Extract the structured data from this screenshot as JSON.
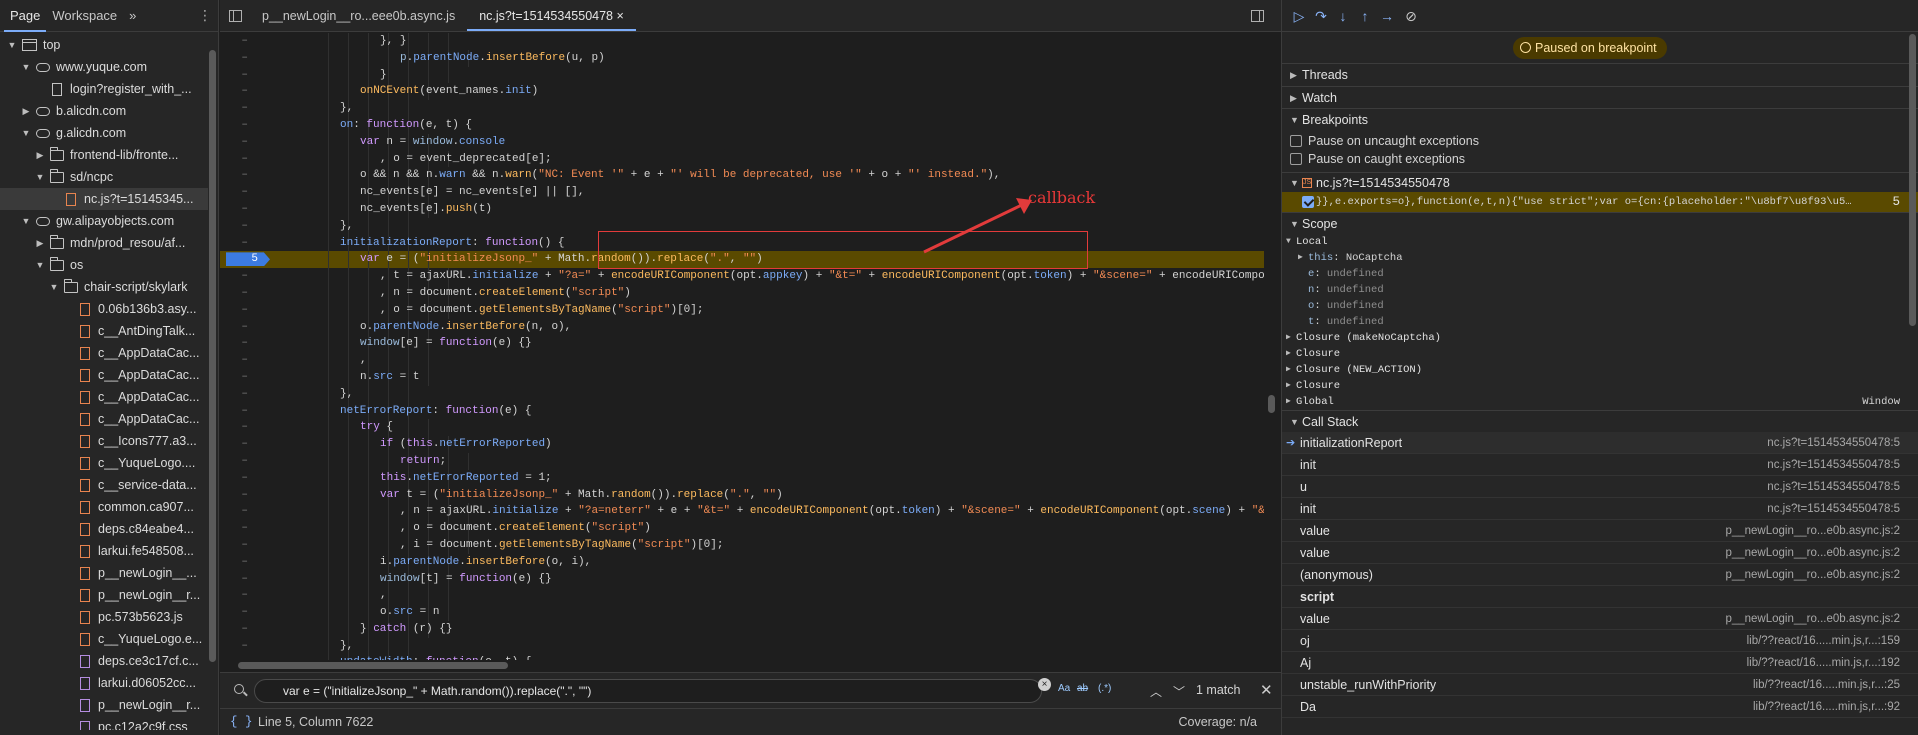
{
  "navigator": {
    "tabs": [
      "Page",
      "Workspace"
    ],
    "more": "»",
    "tree": [
      {
        "label": "top",
        "indent": 0,
        "icon": "frame",
        "arrow": "down"
      },
      {
        "label": "www.yuque.com",
        "indent": 1,
        "icon": "cloud",
        "arrow": "down"
      },
      {
        "label": "login?register_with_...",
        "indent": 2,
        "icon": "doc",
        "arrow": ""
      },
      {
        "label": "b.alicdn.com",
        "indent": 1,
        "icon": "cloud",
        "arrow": "right"
      },
      {
        "label": "g.alicdn.com",
        "indent": 1,
        "icon": "cloud",
        "arrow": "down"
      },
      {
        "label": "frontend-lib/fronte...",
        "indent": 2,
        "icon": "folder",
        "arrow": "right"
      },
      {
        "label": "sd/ncpc",
        "indent": 2,
        "icon": "folder",
        "arrow": "down"
      },
      {
        "label": "nc.js?t=15145345...",
        "indent": 3,
        "icon": "jsdoc",
        "arrow": "",
        "selected": true
      },
      {
        "label": "gw.alipayobjects.com",
        "indent": 1,
        "icon": "cloud",
        "arrow": "down"
      },
      {
        "label": "mdn/prod_resou/af...",
        "indent": 2,
        "icon": "folder",
        "arrow": "right"
      },
      {
        "label": "os",
        "indent": 2,
        "icon": "folder",
        "arrow": "down"
      },
      {
        "label": "chair-script/skylark",
        "indent": 3,
        "icon": "folder",
        "arrow": "down"
      },
      {
        "label": "0.06b136b3.asy...",
        "indent": 4,
        "icon": "jsdoc",
        "arrow": ""
      },
      {
        "label": "c__AntDingTalk...",
        "indent": 4,
        "icon": "jsdoc",
        "arrow": ""
      },
      {
        "label": "c__AppDataCac...",
        "indent": 4,
        "icon": "jsdoc",
        "arrow": ""
      },
      {
        "label": "c__AppDataCac...",
        "indent": 4,
        "icon": "jsdoc",
        "arrow": ""
      },
      {
        "label": "c__AppDataCac...",
        "indent": 4,
        "icon": "jsdoc",
        "arrow": ""
      },
      {
        "label": "c__AppDataCac...",
        "indent": 4,
        "icon": "jsdoc",
        "arrow": ""
      },
      {
        "label": "c__Icons777.a3...",
        "indent": 4,
        "icon": "jsdoc",
        "arrow": ""
      },
      {
        "label": "c__YuqueLogo....",
        "indent": 4,
        "icon": "jsdoc",
        "arrow": ""
      },
      {
        "label": "c__service-data...",
        "indent": 4,
        "icon": "jsdoc",
        "arrow": ""
      },
      {
        "label": "common.ca907...",
        "indent": 4,
        "icon": "jsdoc",
        "arrow": ""
      },
      {
        "label": "deps.c84eabe4...",
        "indent": 4,
        "icon": "jsdoc",
        "arrow": ""
      },
      {
        "label": "larkui.fe548508...",
        "indent": 4,
        "icon": "jsdoc",
        "arrow": ""
      },
      {
        "label": "p__newLogin__...",
        "indent": 4,
        "icon": "jsdoc",
        "arrow": ""
      },
      {
        "label": "p__newLogin__r...",
        "indent": 4,
        "icon": "jsdoc",
        "arrow": ""
      },
      {
        "label": "pc.573b5623.js",
        "indent": 4,
        "icon": "jsdoc",
        "arrow": ""
      },
      {
        "label": "c__YuqueLogo.e...",
        "indent": 4,
        "icon": "jsdoc",
        "arrow": ""
      },
      {
        "label": "deps.ce3c17cf.c...",
        "indent": 4,
        "icon": "cssdoc",
        "arrow": ""
      },
      {
        "label": "larkui.d06052cc...",
        "indent": 4,
        "icon": "cssdoc",
        "arrow": ""
      },
      {
        "label": "p__newLogin__r...",
        "indent": 4,
        "icon": "cssdoc",
        "arrow": ""
      },
      {
        "label": "pc.c12a2c9f.css",
        "indent": 4,
        "icon": "cssdoc",
        "arrow": ""
      }
    ]
  },
  "editor": {
    "tabs": [
      {
        "label": "p__newLogin__ro...eee0b.async.js",
        "active": false
      },
      {
        "label": "nc.js?t=1514534550478",
        "active": true,
        "closable": "×"
      }
    ],
    "annotation": "callback",
    "lines": [
      {
        "gutter": "–",
        "indent": 8,
        "html": "<span class='plain'>}, </span><span class='plain'>}</span>"
      },
      {
        "gutter": "–",
        "indent": 9,
        "html": "<span class='var'>p</span><span class='plain'>.</span><span class='prop'>parentNode</span><span class='plain'>.</span><span class='fn'>insertBefore</span><span class='plain'>(u, p)</span>"
      },
      {
        "gutter": "–",
        "indent": 8,
        "html": "<span class='plain'>}</span>"
      },
      {
        "gutter": "–",
        "indent": 7,
        "html": "<span class='fn'>onNCEvent</span><span class='plain'>(event_names.</span><span class='prop'>init</span><span class='plain'>)</span>"
      },
      {
        "gutter": "–",
        "indent": 6,
        "html": "<span class='plain'>},</span>"
      },
      {
        "gutter": "–",
        "indent": 6,
        "html": "<span class='prop'>on</span><span class='plain'>: </span><span class='kw'>function</span><span class='plain'>(e, t) {</span>"
      },
      {
        "gutter": "–",
        "indent": 7,
        "html": "<span class='kw'>var</span><span class='plain'> n = </span><span class='var'>window</span><span class='plain'>.</span><span class='prop'>console</span>"
      },
      {
        "gutter": "–",
        "indent": 8,
        "html": "<span class='plain'>, o = event_deprecated[e];</span>"
      },
      {
        "gutter": "–",
        "indent": 7,
        "html": "<span class='plain'>o &amp;&amp; n &amp;&amp; n.</span><span class='prop'>warn</span><span class='plain'> &amp;&amp; n.</span><span class='fn'>warn</span><span class='plain'>(</span><span class='str'>\"NC: Event '\"</span><span class='plain'> + e + </span><span class='str'>\"' will be deprecated, use '\"</span><span class='plain'> + o + </span><span class='str'>\"' instead.\"</span><span class='plain'>),</span>"
      },
      {
        "gutter": "–",
        "indent": 7,
        "html": "<span class='plain'>nc_events[e] = nc_events[e] || [],</span>"
      },
      {
        "gutter": "–",
        "indent": 7,
        "html": "<span class='plain'>nc_events[e].</span><span class='fn'>push</span><span class='plain'>(t)</span>"
      },
      {
        "gutter": "–",
        "indent": 6,
        "html": "<span class='plain'>},</span>"
      },
      {
        "gutter": "–",
        "indent": 6,
        "html": "<span class='prop'>initializationReport</span><span class='plain'>: </span><span class='kw'>function</span><span class='plain'>() {</span>"
      },
      {
        "gutter": "5",
        "indent": 7,
        "bp": true,
        "html": "<span class='kw'>var</span><span class='plain'> e = </span><span class='plain'>(</span><span class='str'>\"initializeJsonp_\"</span><span class='plain'> + Math.</span><span class='fn'>random</span><span class='plain'>()).</span><span class='fn'>replace</span><span class='plain'>(</span><span class='str'>\".\"</span><span class='plain'>, </span><span class='str'>\"\"</span><span class='plain'>)</span>"
      },
      {
        "gutter": "–",
        "indent": 8,
        "html": "<span class='plain'>, t = ajaxURL.</span><span class='prop'>initialize</span><span class='plain'> + </span><span class='str'>\"?a=\"</span><span class='plain'> + </span><span class='fn'>encodeURIComponent</span><span class='plain'>(opt.</span><span class='prop'>appkey</span><span class='plain'>) + </span><span class='str'>\"&amp;t=\"</span><span class='plain'> + </span><span class='fn'>encodeURIComponent</span><span class='plain'>(opt.</span><span class='prop'>token</span><span class='plain'>) + </span><span class='str'>\"&amp;scene=\"</span><span class='plain'> + encodeURIComponent</span>"
      },
      {
        "gutter": "–",
        "indent": 8,
        "html": "<span class='plain'>, n = document.</span><span class='fn'>createElement</span><span class='plain'>(</span><span class='str'>\"script\"</span><span class='plain'>)</span>"
      },
      {
        "gutter": "–",
        "indent": 8,
        "html": "<span class='plain'>, o = document.</span><span class='fn'>getElementsByTagName</span><span class='plain'>(</span><span class='str'>\"script\"</span><span class='plain'>)[0];</span>"
      },
      {
        "gutter": "–",
        "indent": 7,
        "html": "<span class='plain'>o.</span><span class='prop'>parentNode</span><span class='plain'>.</span><span class='fn'>insertBefore</span><span class='plain'>(n, o),</span>"
      },
      {
        "gutter": "–",
        "indent": 7,
        "html": "<span class='var'>window</span><span class='plain'>[e] = </span><span class='kw'>function</span><span class='plain'>(e) {}</span>"
      },
      {
        "gutter": "–",
        "indent": 7,
        "html": "<span class='plain'>,</span>"
      },
      {
        "gutter": "–",
        "indent": 7,
        "html": "<span class='plain'>n.</span><span class='prop'>src</span><span class='plain'> = t</span>"
      },
      {
        "gutter": "–",
        "indent": 6,
        "html": "<span class='plain'>},</span>"
      },
      {
        "gutter": "–",
        "indent": 6,
        "html": "<span class='prop'>netErrorReport</span><span class='plain'>: </span><span class='kw'>function</span><span class='plain'>(e) {</span>"
      },
      {
        "gutter": "–",
        "indent": 7,
        "html": "<span class='kw'>try</span><span class='plain'> {</span>"
      },
      {
        "gutter": "–",
        "indent": 8,
        "html": "<span class='kw'>if</span><span class='plain'> (</span><span class='kw'>this</span><span class='plain'>.</span><span class='prop'>netErrorReported</span><span class='plain'>)</span>"
      },
      {
        "gutter": "–",
        "indent": 9,
        "html": "<span class='kw'>return</span><span class='plain'>;</span>"
      },
      {
        "gutter": "–",
        "indent": 8,
        "html": "<span class='kw'>this</span><span class='plain'>.</span><span class='prop'>netErrorReported</span><span class='plain'> = 1;</span>"
      },
      {
        "gutter": "–",
        "indent": 8,
        "html": "<span class='kw'>var</span><span class='plain'> t = (</span><span class='str'>\"initializeJsonp_\"</span><span class='plain'> + Math.</span><span class='fn'>random</span><span class='plain'>()).</span><span class='fn'>replace</span><span class='plain'>(</span><span class='str'>\".\"</span><span class='plain'>, </span><span class='str'>\"\"</span><span class='plain'>)</span>"
      },
      {
        "gutter": "–",
        "indent": 9,
        "html": "<span class='plain'>, n = ajaxURL.</span><span class='prop'>initialize</span><span class='plain'> + </span><span class='str'>\"?a=neterr\"</span><span class='plain'> + e + </span><span class='str'>\"&amp;t=\"</span><span class='plain'> + </span><span class='fn'>encodeURIComponent</span><span class='plain'>(opt.</span><span class='prop'>token</span><span class='plain'>) + </span><span class='str'>\"&amp;scene=\"</span><span class='plain'> + </span><span class='fn'>encodeURIComponent</span><span class='plain'>(opt.</span><span class='prop'>scene</span><span class='plain'>) + </span><span class='str'>\"&amp;la</span>"
      },
      {
        "gutter": "–",
        "indent": 9,
        "html": "<span class='plain'>, o = document.</span><span class='fn'>createElement</span><span class='plain'>(</span><span class='str'>\"script\"</span><span class='plain'>)</span>"
      },
      {
        "gutter": "–",
        "indent": 9,
        "html": "<span class='plain'>, i = document.</span><span class='fn'>getElementsByTagName</span><span class='plain'>(</span><span class='str'>\"script\"</span><span class='plain'>)[0];</span>"
      },
      {
        "gutter": "–",
        "indent": 8,
        "html": "<span class='plain'>i.</span><span class='prop'>parentNode</span><span class='plain'>.</span><span class='fn'>insertBefore</span><span class='plain'>(o, i),</span>"
      },
      {
        "gutter": "–",
        "indent": 8,
        "html": "<span class='var'>window</span><span class='plain'>[t] = </span><span class='kw'>function</span><span class='plain'>(e) {}</span>"
      },
      {
        "gutter": "–",
        "indent": 8,
        "html": "<span class='plain'>,</span>"
      },
      {
        "gutter": "–",
        "indent": 8,
        "html": "<span class='plain'>o.</span><span class='prop'>src</span><span class='plain'> = n</span>"
      },
      {
        "gutter": "–",
        "indent": 7,
        "html": "<span class='plain'>} </span><span class='kw'>catch</span><span class='plain'> (r) {}</span>"
      },
      {
        "gutter": "–",
        "indent": 6,
        "html": "<span class='plain'>},</span>"
      },
      {
        "gutter": "–",
        "indent": 6,
        "html": "<span class='prop'>updateWidth</span><span class='plain'>: </span><span class='kw'>function</span><span class='plain'>(e, t) {</span>"
      }
    ]
  },
  "search": {
    "value": "var e = (\"initializeJsonp_\" + Math.random()).replace(\".\", \"\")",
    "opt_case": "Aa",
    "opt_word": "ab",
    "opt_regex": "(.*)",
    "match_count": "1 match"
  },
  "status": {
    "pretty_print": "{ }",
    "cursor": "Line 5, Column 7622",
    "coverage": "Coverage: n/a"
  },
  "debugger": {
    "paused": "Paused on breakpoint",
    "sections": {
      "threads": "Threads",
      "watch": "Watch",
      "breakpoints": "Breakpoints",
      "scope": "Scope",
      "call_stack": "Call Stack"
    },
    "pause_uncaught": "Pause on uncaught exceptions",
    "pause_caught": "Pause on caught exceptions",
    "bp_file": "nc.js?t=1514534550478",
    "bp_code": "}},e.exports=o},function(e,t,n){\"use strict\";var o={cn:{placeholder:\"\\u8bf7\\u8f93\\u5165\\u9...",
    "bp_line": "5",
    "scope": {
      "local": "Local",
      "this_key": "this",
      "this_val": "NoCaptcha",
      "vars": [
        {
          "key": "e",
          "val": "undefined"
        },
        {
          "key": "n",
          "val": "undefined"
        },
        {
          "key": "o",
          "val": "undefined"
        },
        {
          "key": "t",
          "val": "undefined"
        }
      ],
      "closures": [
        "Closure (makeNoCaptcha)",
        "Closure",
        "Closure (NEW_ACTION)",
        "Closure"
      ],
      "global": "Global",
      "global_val": "Window"
    },
    "call_stack": [
      {
        "name": "initializationReport",
        "loc": "nc.js?t=1514534550478:5",
        "current": true
      },
      {
        "name": "init",
        "loc": "nc.js?t=1514534550478:5"
      },
      {
        "name": "u",
        "loc": "nc.js?t=1514534550478:5"
      },
      {
        "name": "init",
        "loc": "nc.js?t=1514534550478:5"
      },
      {
        "name": "value",
        "loc": "p__newLogin__ro...e0b.async.js:2"
      },
      {
        "name": "value",
        "loc": "p__newLogin__ro...e0b.async.js:2"
      },
      {
        "name": "(anonymous)",
        "loc": "p__newLogin__ro...e0b.async.js:2"
      },
      {
        "name": "script",
        "loc": "",
        "group": true
      },
      {
        "name": "value",
        "loc": "p__newLogin__ro...e0b.async.js:2"
      },
      {
        "name": "oj",
        "loc": "lib/??react/16.....min.js,r...:159"
      },
      {
        "name": "Aj",
        "loc": "lib/??react/16.....min.js,r...:192"
      },
      {
        "name": "unstable_runWithPriority",
        "loc": "lib/??react/16.....min.js,r...:25"
      },
      {
        "name": "Da",
        "loc": "lib/??react/16.....min.js,r...:92"
      }
    ]
  }
}
